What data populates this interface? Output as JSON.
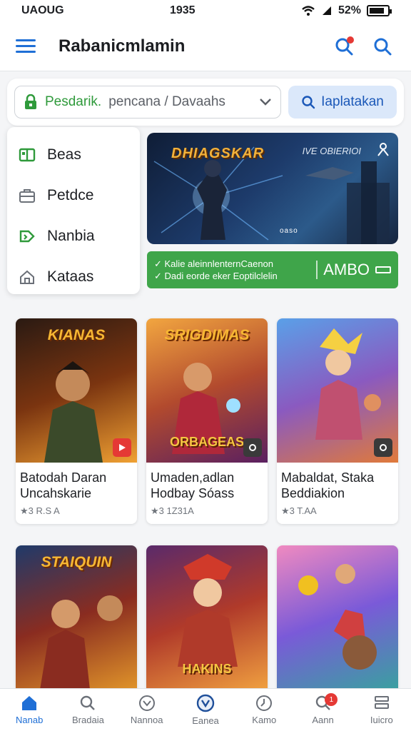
{
  "status": {
    "left": "UAOUG",
    "time": "1935",
    "battery": "52%"
  },
  "appbar": {
    "title": "Rabanicmlamin"
  },
  "search": {
    "category_label": "Pesdarik.",
    "category_value": "pencana / Davaahs",
    "button_label": "Iaplatakan"
  },
  "menu": {
    "items": [
      {
        "label": "Beas"
      },
      {
        "label": "Petdce"
      },
      {
        "label": "Nanbia"
      },
      {
        "label": "Kataas"
      }
    ]
  },
  "banner": {
    "title": "DHIAGSKAR",
    "subtitle": "IVE OBIERIOI",
    "dots": "oaso"
  },
  "promo": {
    "line1": "Kalie aleinnlenternCaenon",
    "line2": "Dadi eorde eker Eoptilclelin",
    "label": "AMBO"
  },
  "games": [
    {
      "thumb_title": "KIANAS",
      "thumb_title2": "",
      "title": "Batodah Daran",
      "subtitle": "Uncahskarie",
      "meta": "★3 R.S A",
      "colors": [
        "#2a1a12",
        "#7a3410",
        "#f0a133"
      ],
      "badge_color": "#e53935"
    },
    {
      "thumb_title": "SRIGDIMAS",
      "thumb_title2": "ORBAGEAS",
      "title": "Umaden,adlan",
      "subtitle": "Hodbay Sóass",
      "meta": "★3 1Z31A",
      "colors": [
        "#f2a640",
        "#b24a2e",
        "#5a2060"
      ],
      "badge_color": "#3a3a3a"
    },
    {
      "thumb_title": "",
      "thumb_title2": "",
      "title": "Mabaldat, Staka",
      "subtitle": "Beddiakion",
      "meta": "★3 T.AA",
      "colors": [
        "#5aa0e8",
        "#8a5ac0",
        "#e07a3a"
      ],
      "badge_color": "#3a3a3a"
    },
    {
      "thumb_title": "STAIQUIN",
      "thumb_title2": "",
      "title": "",
      "subtitle": "",
      "meta": "",
      "colors": [
        "#1f3a6a",
        "#8a2c20",
        "#e0942a"
      ],
      "badge_color": "#3a3a3a"
    },
    {
      "thumb_title": "",
      "thumb_title2": "HAKINS",
      "title": "",
      "subtitle": "",
      "meta": "",
      "colors": [
        "#5a2a6a",
        "#b03a2a",
        "#f0a040"
      ],
      "badge_color": "#e53935"
    },
    {
      "thumb_title": "",
      "thumb_title2": "",
      "title": "",
      "subtitle": "",
      "meta": "",
      "colors": [
        "#f08ac0",
        "#7a5ad8",
        "#3aa0a0"
      ],
      "badge_color": "#3a3a3a"
    }
  ],
  "nav": {
    "items": [
      {
        "label": "Nanab"
      },
      {
        "label": "Bradaia"
      },
      {
        "label": "Nannoa"
      },
      {
        "label": "Eanea"
      },
      {
        "label": "Kamo"
      },
      {
        "label": "Aann"
      },
      {
        "label": "Iuicro"
      }
    ],
    "badge": "1"
  },
  "colors": {
    "accent": "#1f6fd6",
    "green": "#3fa54a",
    "notify": "#e53935"
  }
}
